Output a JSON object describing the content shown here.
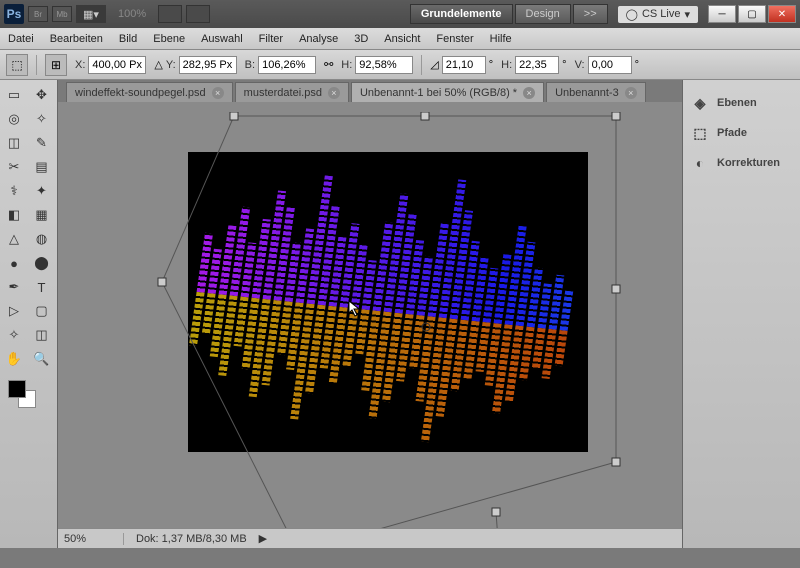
{
  "titlebar": {
    "logo": "Ps",
    "br": "Br",
    "mb": "Mb",
    "zoom": "100%"
  },
  "workspace": {
    "active": "Grundelemente",
    "design": "Design",
    "more": ">>",
    "cslive": "CS Live"
  },
  "menu": [
    "Datei",
    "Bearbeiten",
    "Bild",
    "Ebene",
    "Auswahl",
    "Filter",
    "Analyse",
    "3D",
    "Ansicht",
    "Fenster",
    "Hilfe"
  ],
  "options": {
    "x_label": "X:",
    "x": "400,00 Px",
    "y_label": "Y:",
    "y": "282,95 Px",
    "b_label": "B:",
    "b": "106,26%",
    "h_label": "H:",
    "h": "92,58%",
    "angle_label": "",
    "angle": "21,10",
    "h2_label": "H:",
    "h2": "22,35",
    "v_label": "V:",
    "v": "0,00"
  },
  "tabs": [
    {
      "label": "windeffekt-soundpegel.psd",
      "active": false
    },
    {
      "label": "musterdatei.psd",
      "active": false
    },
    {
      "label": "Unbenannt-1 bei 50% (RGB/8) *",
      "active": true
    },
    {
      "label": "Unbenannt-3",
      "active": false
    }
  ],
  "status": {
    "zoom": "50%",
    "dok": "Dok: 1,37 MB/8,30 MB"
  },
  "panels": [
    {
      "icon": "◈",
      "label": "Ebenen"
    },
    {
      "icon": "⬚",
      "label": "Pfade"
    },
    {
      "icon": "◐",
      "label": "Korrekturen"
    }
  ],
  "tools": [
    "▭",
    "✥",
    "◎",
    "✧",
    "◫",
    "✎",
    "✂",
    "▤",
    "⚕",
    "✦",
    "◧",
    "▦",
    "△",
    "◍",
    "●",
    "⬤",
    "✒",
    "T",
    "▷",
    "▢",
    "✧",
    "◫",
    "✋",
    "🔍"
  ]
}
